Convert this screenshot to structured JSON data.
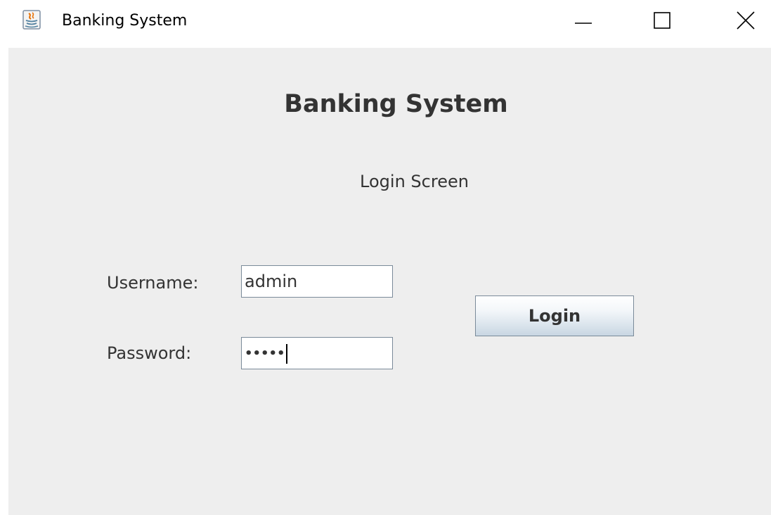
{
  "window": {
    "title": "Banking System",
    "controls": {
      "minimize": "minimize-icon",
      "maximize": "maximize-icon",
      "close": "close-icon"
    }
  },
  "login": {
    "heading": "Banking System",
    "subheading": "Login Screen",
    "username_label": "Username:",
    "username_value": "admin",
    "password_label": "Password:",
    "password_masked": "•••••",
    "button_label": "Login"
  },
  "colors": {
    "content_background": "#eeeeee",
    "text": "#333333",
    "field_border": "#7a8a99"
  }
}
